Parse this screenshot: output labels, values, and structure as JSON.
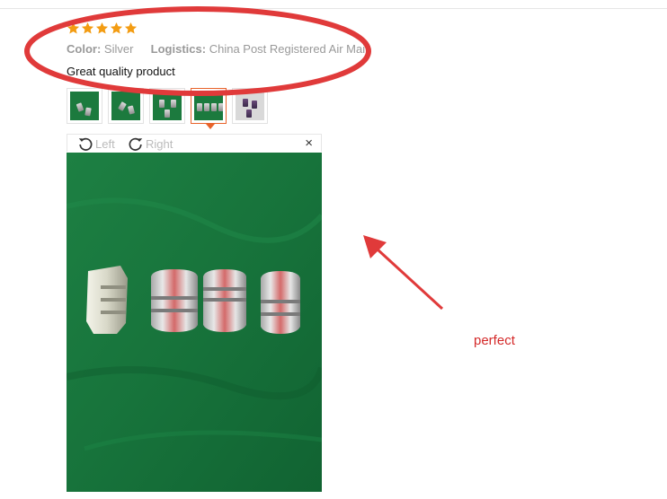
{
  "review": {
    "rating": 5,
    "color_label": "Color:",
    "color_value": "Silver",
    "logistics_label": "Logistics:",
    "logistics_value": "China Post Registered Air Mail",
    "text": "Great quality product"
  },
  "thumbnails": {
    "count": 5,
    "active_index": 3
  },
  "viewer": {
    "rotate_left_label": "Left",
    "rotate_right_label": "Right",
    "close_label": "×"
  },
  "annotation": {
    "text": "perfect"
  },
  "colors": {
    "star": "#f39c12",
    "accent": "#e8632a",
    "annotation_red": "#e03a3a",
    "photo_green": "#1a7b3f"
  },
  "icons": [
    "star-icon",
    "rotate-left-icon",
    "rotate-right-icon",
    "close-icon"
  ]
}
